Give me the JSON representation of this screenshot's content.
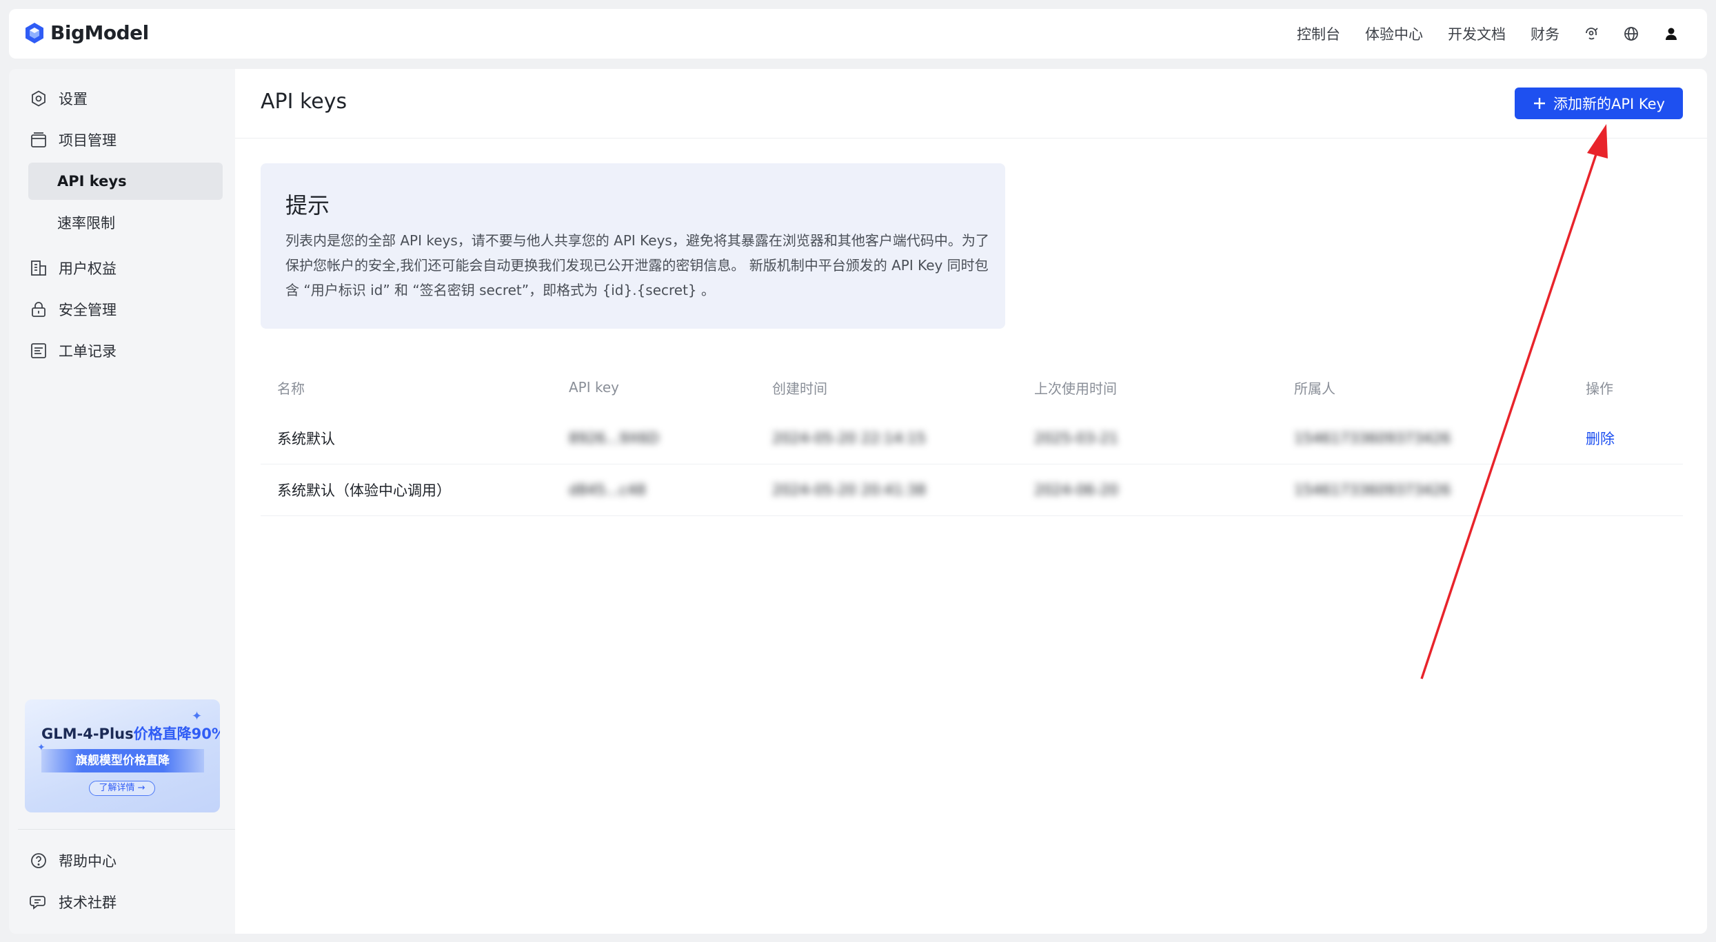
{
  "brand": {
    "name": "BigModel"
  },
  "nav": {
    "links": [
      "控制台",
      "体验中心",
      "开发文档",
      "财务"
    ]
  },
  "sidebar": {
    "items": [
      "设置",
      "项目管理",
      "用户权益",
      "安全管理",
      "工单记录"
    ],
    "subitems": [
      "API keys",
      "速率限制"
    ],
    "bottom": [
      "帮助中心",
      "技术社群"
    ]
  },
  "promo": {
    "title": "GLM-4-Plus",
    "title_highlight": "价格直降90%",
    "band": "旗舰模型价格直降",
    "button": "了解详情 →"
  },
  "main": {
    "title": "API keys",
    "add_button": "添加新的API Key",
    "tip": {
      "title": "提示",
      "body": "列表内是您的全部 API keys，请不要与他人共享您的 API Keys，避免将其暴露在浏览器和其他客户端代码中。为了保护您帐户的安全,我们还可能会自动更换我们发现已公开泄露的密钥信息。 新版机制中平台颁发的 API Key 同时包含 “用户标识 id” 和 “签名密钥 secret”，即格式为 {id}.{secret} 。"
    },
    "table": {
      "headers": [
        "名称",
        "API key",
        "创建时间",
        "上次使用时间",
        "所属人",
        "操作"
      ],
      "rows": [
        {
          "name": "系统默认",
          "key": "8926...9X6D",
          "created": "2024-05-20 22:14:15",
          "last_used": "2025-03-21",
          "owner": "15461733609373426",
          "action": "删除"
        },
        {
          "name": "系统默认（体验中心调用）",
          "key": "d845...c48",
          "created": "2024-05-20 20:41:38",
          "last_used": "2024-06-20",
          "owner": "15461733609373426",
          "action": ""
        }
      ]
    }
  },
  "colors": {
    "primary": "#1e50f0",
    "annotation_arrow": "#e8242b"
  }
}
